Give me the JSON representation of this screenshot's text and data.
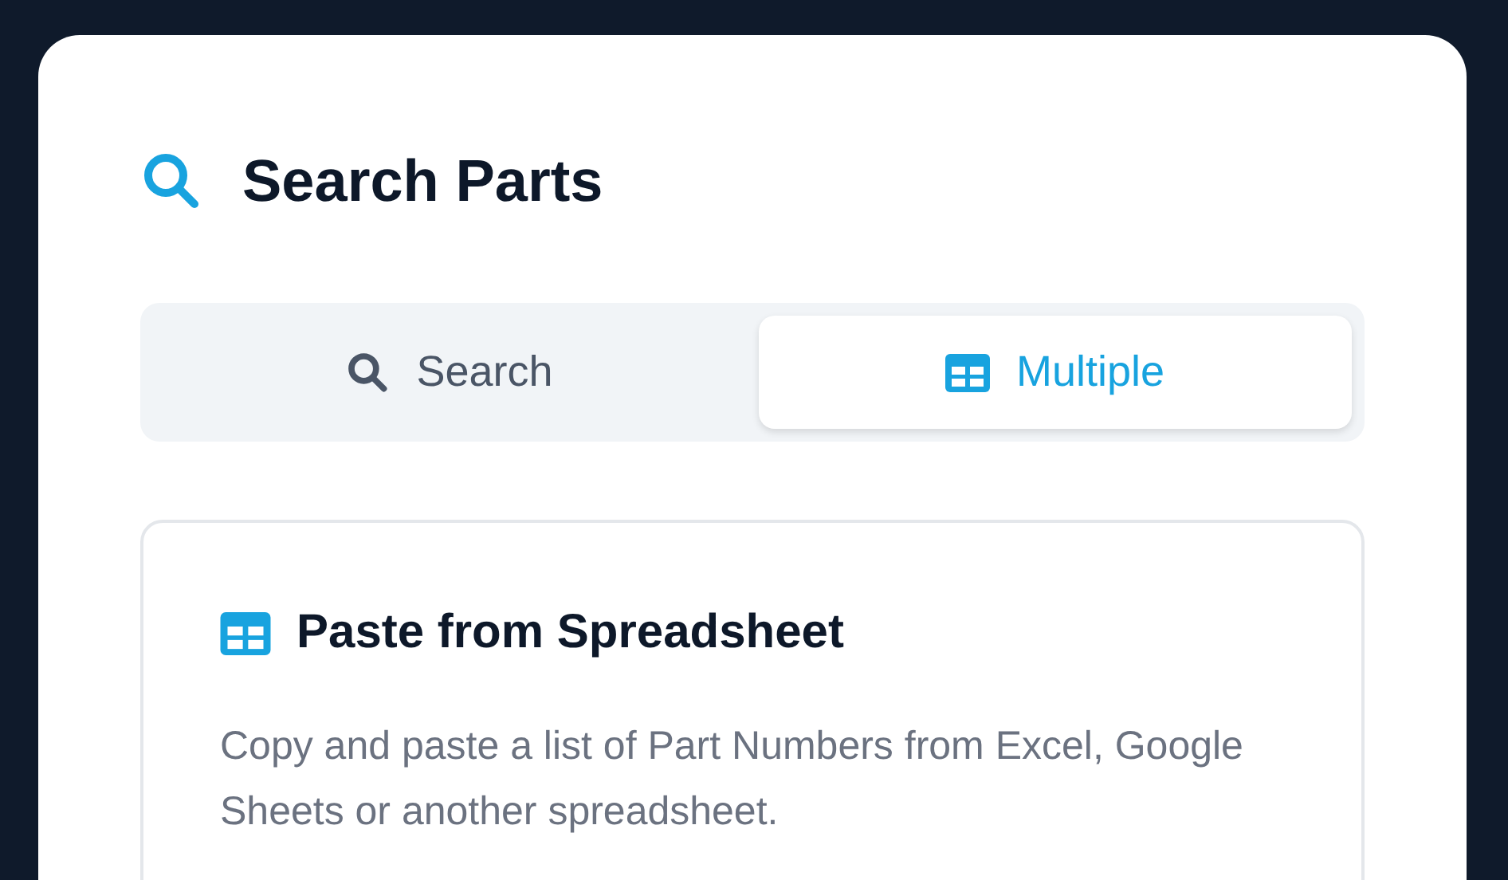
{
  "title": "Search Parts",
  "tabs": [
    {
      "label": "Search",
      "kind": "search",
      "selected": false
    },
    {
      "label": "Multiple",
      "kind": "grid",
      "selected": true
    }
  ],
  "card": {
    "title": "Paste from Spreadsheet",
    "description": "Copy and paste a list of Part Numbers from Excel, Google Sheets or another spreadsheet."
  }
}
